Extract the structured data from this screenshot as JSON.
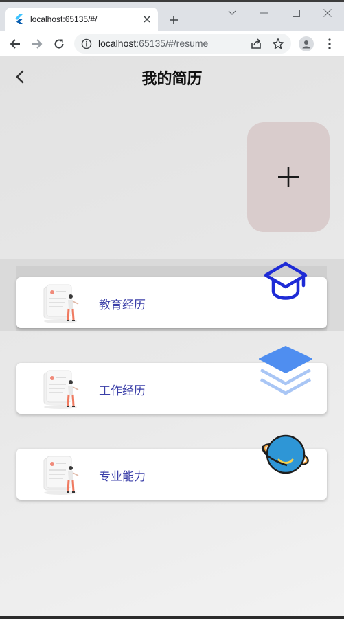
{
  "browser": {
    "tab_title": "localhost:65135/#/",
    "url_host": "localhost",
    "url_rest": ":65135/#/resume"
  },
  "page": {
    "title": "我的简历",
    "add_symbol": "+"
  },
  "sections": [
    {
      "label": "教育经历",
      "icon": "graduation-cap-icon"
    },
    {
      "label": "工作经历",
      "icon": "layers-icon"
    },
    {
      "label": "专业能力",
      "icon": "planet-icon"
    }
  ],
  "colors": {
    "accent_text": "#3b3fa8",
    "add_button_bg": "#d9cccc",
    "cap_icon": "#1e2bd6",
    "layers_icon": "#4f8ef0",
    "planet_icon": "#2e96d6"
  }
}
